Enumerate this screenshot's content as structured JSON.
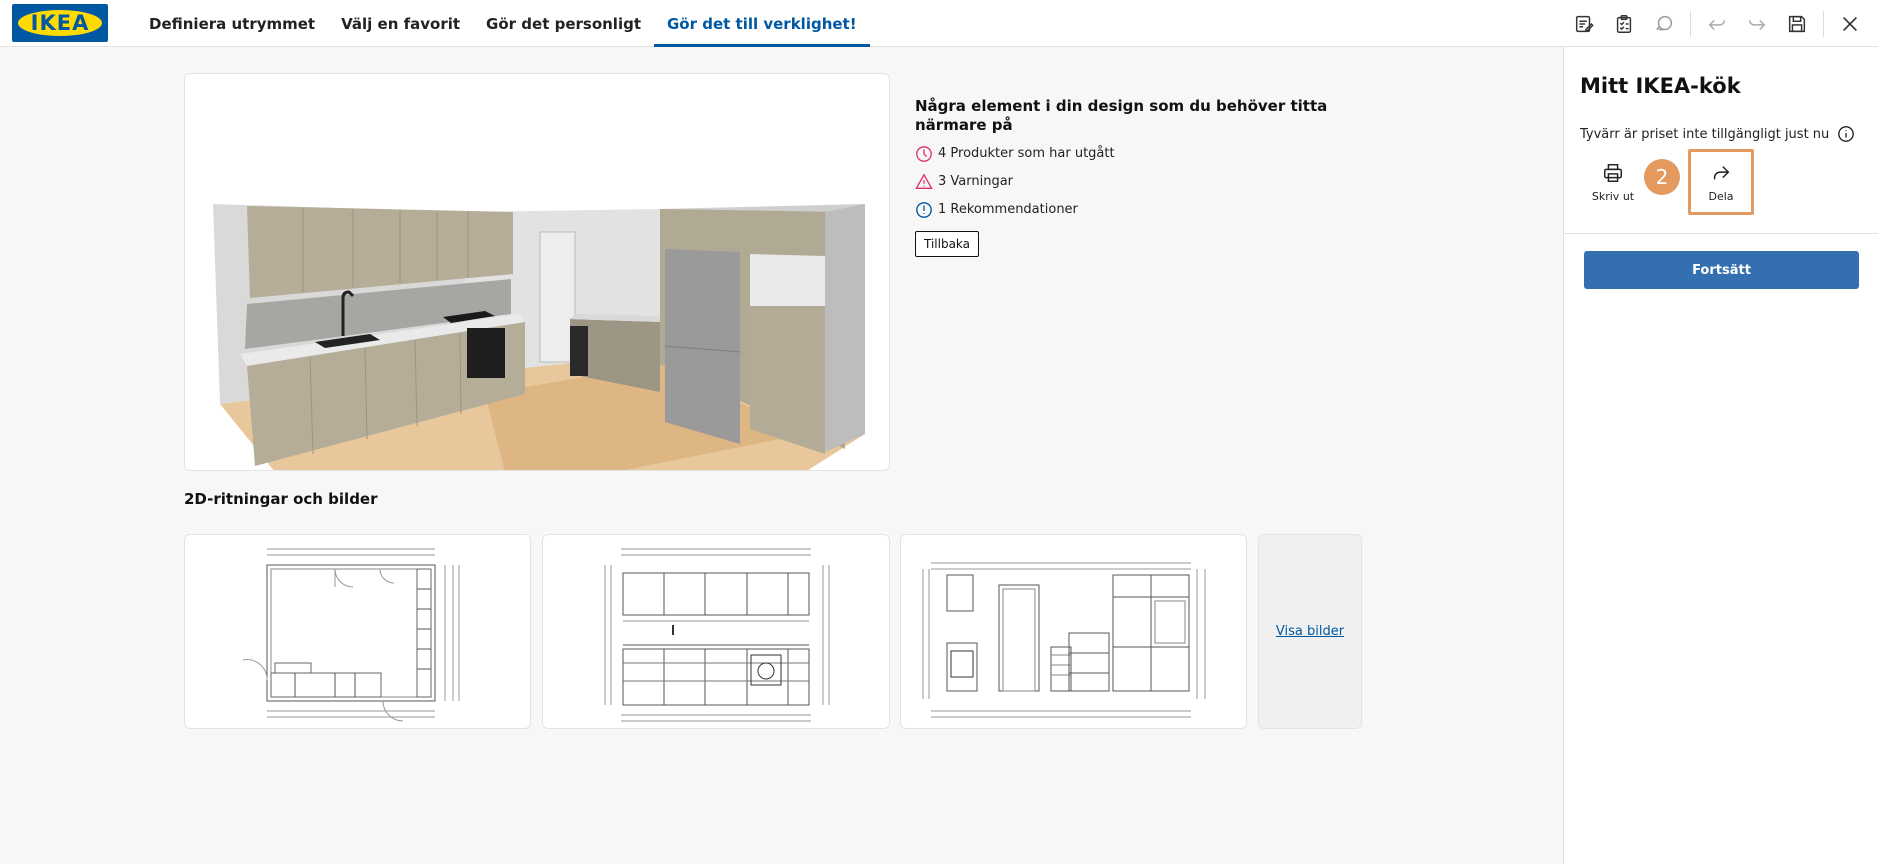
{
  "header": {
    "logo_text": "IKEA",
    "tabs": [
      {
        "label": "Definiera utrymmet",
        "active": false
      },
      {
        "label": "Välj en favorit",
        "active": false
      },
      {
        "label": "Gör det personligt",
        "active": false
      },
      {
        "label": "Gör det till verklighet!",
        "active": true
      }
    ],
    "toolbar_icons": [
      "notes-icon",
      "checklist-icon",
      "rotate-view-icon",
      "undo-icon",
      "redo-icon",
      "save-icon",
      "close-icon"
    ]
  },
  "issues": {
    "title": "Några element i din design som du behöver titta närmare på",
    "items": [
      {
        "text": "4 Produkter som har utgått",
        "icon": "clock-icon",
        "color": "#e0306e"
      },
      {
        "text": "3 Varningar",
        "icon": "warning-icon",
        "color": "#e0306e"
      },
      {
        "text": "1 Rekommendationer",
        "icon": "info-icon",
        "color": "#0058a3"
      }
    ],
    "back_label": "Tillbaka"
  },
  "drawings": {
    "title": "2D-ritningar och bilder",
    "items": [
      "floor-plan",
      "elevation-sink-wall",
      "elevation-door-wall"
    ],
    "more_label": "Visa bilder"
  },
  "panel": {
    "title": "Mitt IKEA-kök",
    "price_note": "Tyvärr är priset inte tillgängligt just nu",
    "print_label": "Skriv ut",
    "share_label": "Dela",
    "step_badge": "2",
    "continue_label": "Fortsätt"
  },
  "colors": {
    "brand_blue": "#0058a3",
    "brand_yellow": "#ffdb00",
    "highlight_orange": "#e49a5e",
    "continue_button": "#3470b0"
  }
}
